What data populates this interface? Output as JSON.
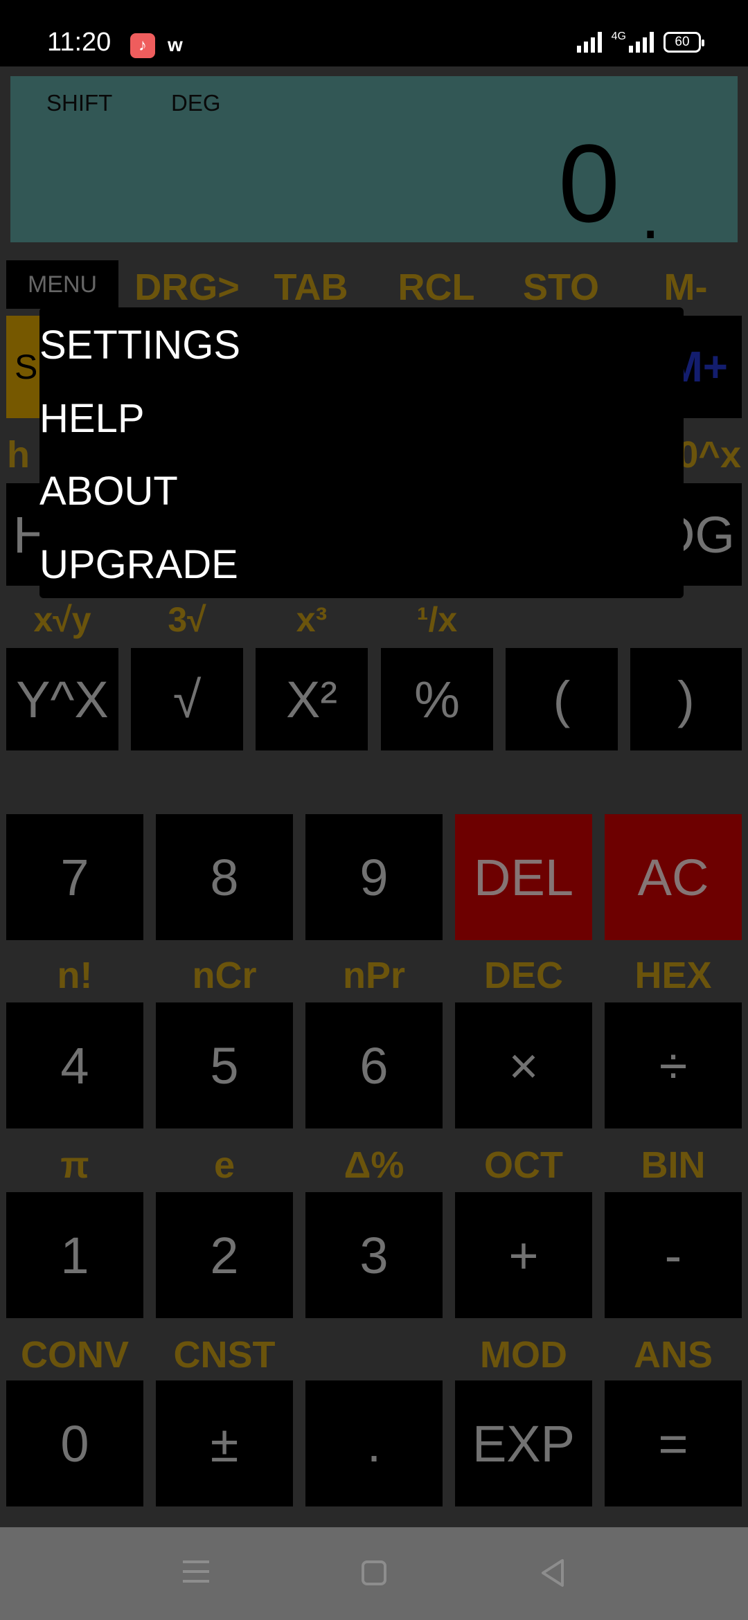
{
  "status_bar": {
    "time": "11:20",
    "network": "4G",
    "battery": "60"
  },
  "display": {
    "shift": "SHIFT",
    "deg": "DEG",
    "value": "0",
    "dot": "."
  },
  "menu_tab": "MENU",
  "top_row_labels": [
    "DRG>",
    "TAB",
    "RCL",
    "STO",
    "M-"
  ],
  "partial_right_labels": [
    "M+",
    "0^x",
    "OG"
  ],
  "partial_left_labels": [
    "S",
    "h",
    "H"
  ],
  "popup_menu": {
    "items": [
      "SETTINGS",
      "HELP",
      "ABOUT",
      "UPGRADE"
    ]
  },
  "row_func_labels": [
    "x√y",
    "3√",
    "x³",
    "¹/x"
  ],
  "row_func_keys": [
    "Y^X",
    "√",
    "X²",
    "%",
    "(",
    ")"
  ],
  "row7_keys": [
    "7",
    "8",
    "9",
    "DEL",
    "AC"
  ],
  "row4_labels": [
    "n!",
    "nCr",
    "nPr",
    "DEC",
    "HEX"
  ],
  "row4_keys": [
    "4",
    "5",
    "6",
    "×",
    "÷"
  ],
  "row1_labels": [
    "π",
    "e",
    "Δ%",
    "OCT",
    "BIN"
  ],
  "row1_keys": [
    "1",
    "2",
    "3",
    "+",
    "-"
  ],
  "row0_labels": [
    "CONV",
    "CNST",
    "",
    "MOD",
    "ANS"
  ],
  "row0_keys": [
    "0",
    "±",
    ".",
    "EXP",
    "="
  ],
  "colors": {
    "display_bg": "#5b9f9b",
    "label_gold": "#c49a16",
    "key_red": "#c60000",
    "key_bg": "#000000",
    "panel_bg": "#4c4c4c"
  }
}
